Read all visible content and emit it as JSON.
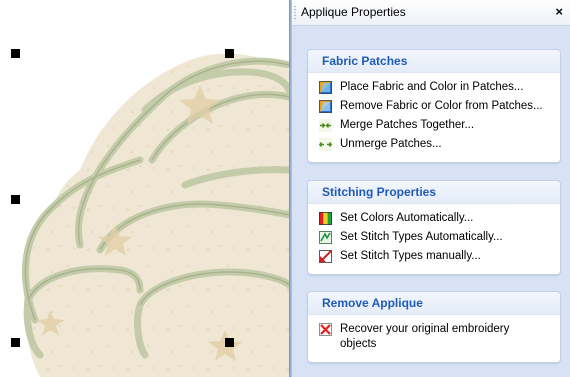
{
  "panel": {
    "title": "Applique Properties",
    "close_glyph": "×"
  },
  "groups": [
    {
      "header": "Fabric Patches",
      "items": [
        {
          "label": "Place Fabric and Color in Patches...",
          "icon": "place-fabric-icon"
        },
        {
          "label": "Remove Fabric or Color from Patches...",
          "icon": "remove-fabric-icon"
        },
        {
          "label": "Merge Patches Together...",
          "icon": "merge-patches-icon"
        },
        {
          "label": "Unmerge Patches...",
          "icon": "unmerge-patches-icon"
        }
      ]
    },
    {
      "header": "Stitching Properties",
      "items": [
        {
          "label": "Set Colors Automatically...",
          "icon": "set-colors-icon"
        },
        {
          "label": "Set Stitch Types Automatically...",
          "icon": "set-stitch-auto-icon"
        },
        {
          "label": "Set Stitch Types manually...",
          "icon": "set-stitch-manual-icon"
        }
      ]
    },
    {
      "header": "Remove Applique",
      "items": [
        {
          "label": "Recover your original embroidery objects",
          "icon": "recover-embroidery-icon"
        }
      ]
    }
  ],
  "colors": {
    "panel_bg": "#d7e3f4",
    "header_text": "#1f5bb8",
    "fabric_fill": "#efe6cf",
    "satin_edge": "#c9cfb0"
  }
}
